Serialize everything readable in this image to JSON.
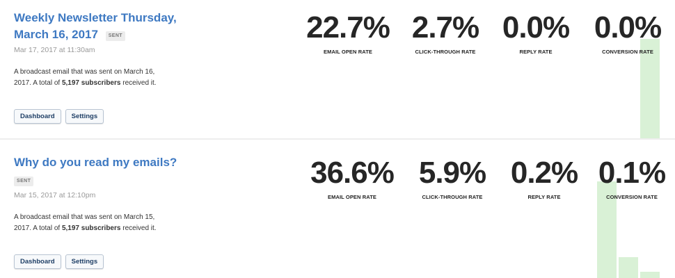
{
  "campaigns": [
    {
      "title": "Weekly Newsletter Thursday, March 16, 2017",
      "title_line1": "Weekly Newsletter Thursday,",
      "title_line2": "March 16, 2017",
      "status": "SENT",
      "date": "Mar 17, 2017 at 11:30am",
      "description_prefix": "A broadcast email that was sent on March 16, 2017. A total of",
      "subscribers": "5,197 subscribers",
      "description_suffix": "received it.",
      "buttons": {
        "dashboard": "Dashboard",
        "settings": "Settings"
      },
      "metrics": [
        {
          "value": "22.7%",
          "label": "EMAIL OPEN RATE"
        },
        {
          "value": "2.7%",
          "label": "CLICK-THROUGH RATE"
        },
        {
          "value": "0.0%",
          "label": "REPLY RATE"
        },
        {
          "value": "0.0%",
          "label": "CONVERSION RATE"
        }
      ]
    },
    {
      "title": "Why do you read my emails?",
      "status": "SENT",
      "date": "Mar 15, 2017 at 12:10pm",
      "description_prefix": "A broadcast email that was sent on March 15, 2017. A total of",
      "subscribers": "5,197 subscribers",
      "description_suffix": "received it.",
      "buttons": {
        "dashboard": "Dashboard",
        "settings": "Settings"
      },
      "metrics": [
        {
          "value": "36.6%",
          "label": "EMAIL OPEN RATE"
        },
        {
          "value": "5.9%",
          "label": "CLICK-THROUGH RATE"
        },
        {
          "value": "0.2%",
          "label": "REPLY RATE"
        },
        {
          "value": "0.1%",
          "label": "CONVERSION RATE"
        }
      ]
    }
  ],
  "colors": {
    "title": "#3e79c2",
    "chart_bar": "#d9f1d6",
    "metric_value": "#262626"
  }
}
